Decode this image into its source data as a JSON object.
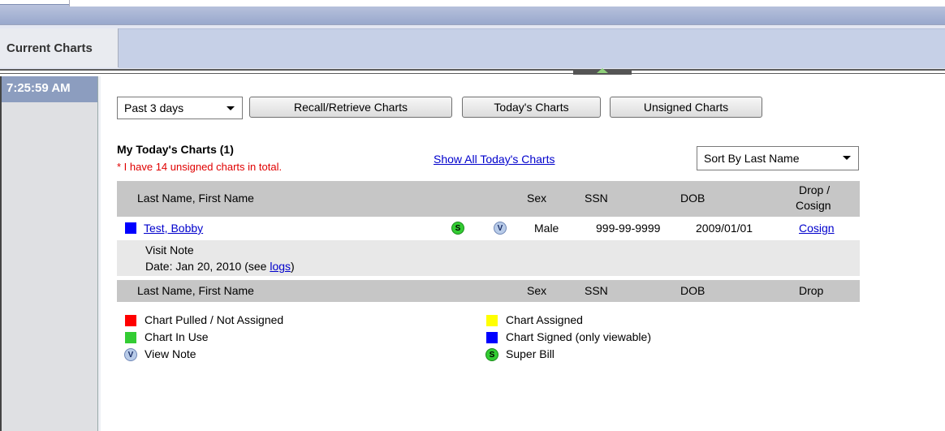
{
  "header": {
    "tab_label": "Current Charts"
  },
  "sidebar": {
    "time": "7:25:59 AM"
  },
  "toolbar": {
    "range_select": "Past 3 days",
    "recall_button": "Recall/Retrieve Charts",
    "today_button": "Today's Charts",
    "unsigned_button": "Unsigned Charts"
  },
  "section": {
    "title": "My Today's Charts (1)",
    "warning": "* I have 14 unsigned charts in total.",
    "show_all_link": "Show All Today's Charts",
    "sort_select": "Sort By Last Name"
  },
  "table": {
    "columns": {
      "name": "Last Name, First Name",
      "sex": "Sex",
      "ssn": "SSN",
      "dob": "DOB",
      "drop_line1": "Drop /",
      "drop_line2": "Cosign"
    },
    "footer_columns": {
      "name": "Last Name, First Name",
      "sex": "Sex",
      "ssn": "SSN",
      "dob": "DOB",
      "drop": "Drop"
    },
    "rows": [
      {
        "name": "Test, Bobby",
        "status_color": "#0000ff",
        "badge_s": "S",
        "badge_v": "V",
        "sex": "Male",
        "ssn": "999-99-9999",
        "dob": "2009/01/01",
        "action": "Cosign",
        "note_title": "Visit Note",
        "note_date_prefix": "Date: Jan 20, 2010 (see ",
        "note_date_link": "logs",
        "note_date_suffix": ")"
      }
    ]
  },
  "legend": {
    "items": [
      {
        "label": "Chart Pulled / Not Assigned",
        "color": "#ff0000"
      },
      {
        "label": "Chart Assigned",
        "color": "#ffff00"
      },
      {
        "label": "Chart In Use",
        "color": "#33cc33"
      },
      {
        "label": "Chart Signed (only viewable)",
        "color": "#0000ff"
      },
      {
        "label": "View Note",
        "icon": "view-note-icon",
        "badge": "V"
      },
      {
        "label": "Super Bill",
        "icon": "super-bill-icon",
        "badge": "S"
      }
    ]
  }
}
